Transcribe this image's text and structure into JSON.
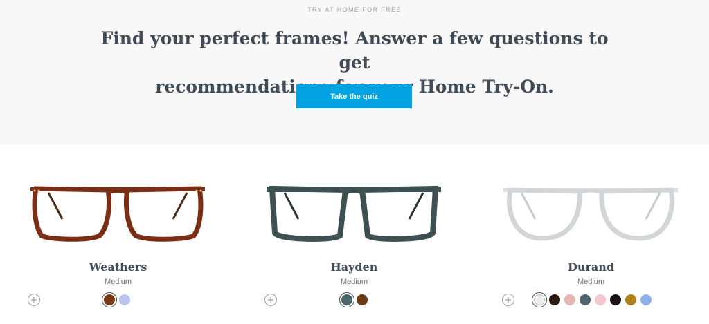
{
  "hero": {
    "eyebrow": "TRY AT HOME FOR FREE",
    "headline_line1": "Find your perfect frames! Answer a few questions to get",
    "headline_line2": "recommendations for your Home Try-On.",
    "quiz_button": "Take the quiz",
    "quiz_button_color": "#00a2e1"
  },
  "products": [
    {
      "name": "Weathers",
      "width": "Medium",
      "frame_color": "#7a2e16",
      "swatches": [
        {
          "color": "#7a3a14",
          "selected": true
        },
        {
          "color": "#b9c5f0",
          "selected": false
        }
      ]
    },
    {
      "name": "Hayden",
      "width": "Medium",
      "frame_color": "#3e5052",
      "swatches": [
        {
          "color": "#4f6772",
          "selected": true
        },
        {
          "color": "#6b3a16",
          "selected": false
        }
      ]
    },
    {
      "name": "Durand",
      "width": "Medium",
      "frame_color": "#d8dadc",
      "swatches": [
        {
          "color": "#eeeeee",
          "selected": true
        },
        {
          "color": "#2a1a10",
          "selected": false
        },
        {
          "color": "#e7b8b3",
          "selected": false
        },
        {
          "color": "#4f6670",
          "selected": false
        },
        {
          "color": "#f6c7d0",
          "selected": false
        },
        {
          "color": "#1a1414",
          "selected": false
        },
        {
          "color": "#b3801f",
          "selected": false
        },
        {
          "color": "#8fb0ea",
          "selected": false
        }
      ]
    }
  ]
}
